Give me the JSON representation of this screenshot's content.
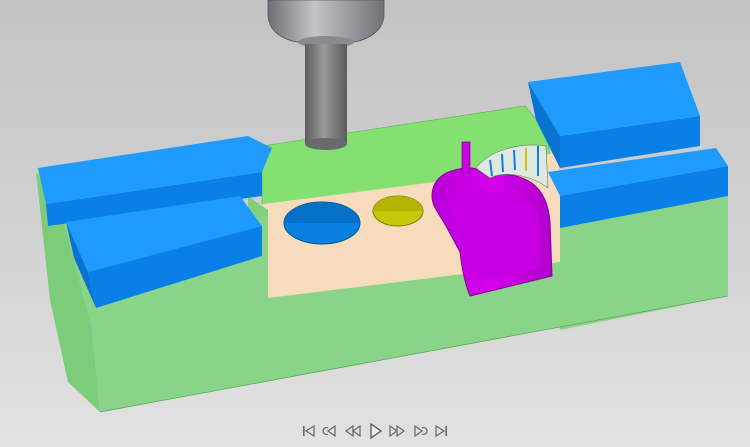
{
  "scene": {
    "colors": {
      "background_top": "#c3c3c3",
      "background_bottom": "#e2e2e2",
      "body": "#8ad48a",
      "body_top": "#84e070",
      "clamp": "#0b8ff0",
      "floor": "#f6dcbc",
      "hole_large": "#0a80e0",
      "hole_small": "#c8c80a",
      "pocket": "#cc00e6",
      "tool_shank": "#7d7d7d",
      "tool_holder": "#9c9ca2"
    }
  },
  "playback": {
    "controls": [
      {
        "name": "skip-to-start-icon",
        "glyph": "skip-start"
      },
      {
        "name": "step-back-icon",
        "glyph": "step-back"
      },
      {
        "name": "rewind-icon",
        "glyph": "rewind"
      },
      {
        "name": "play-icon",
        "glyph": "play"
      },
      {
        "name": "fast-forward-icon",
        "glyph": "fast-forward"
      },
      {
        "name": "step-forward-icon",
        "glyph": "step-forward"
      },
      {
        "name": "skip-to-end-icon",
        "glyph": "skip-end"
      }
    ]
  }
}
